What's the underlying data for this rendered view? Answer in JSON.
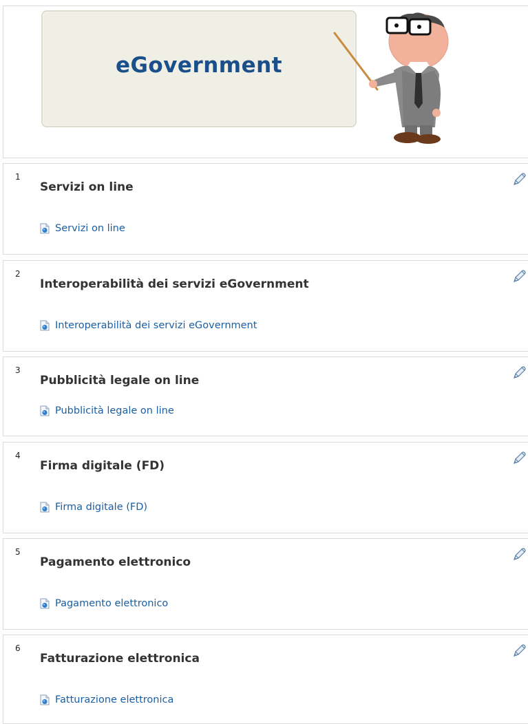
{
  "banner": {
    "title": "eGovernment"
  },
  "colors": {
    "link": "#1a5fa3",
    "title": "#333333",
    "banner_title": "#1a4f8a",
    "board_bg": "#efefe6"
  },
  "sections": [
    {
      "number": "1",
      "title": "Servizi on line",
      "link": "Servizi on line",
      "icon": "document-icon",
      "action_icon": "edit-pencil-icon"
    },
    {
      "number": "2",
      "title": "Interoperabilità dei servizi eGovernment",
      "link": "Interoperabilità dei servizi eGovernment",
      "icon": "document-icon",
      "action_icon": "edit-pencil-icon"
    },
    {
      "number": "3",
      "title": "Pubblicità legale on line",
      "link": "Pubblicità legale on line",
      "icon": "document-icon",
      "action_icon": "edit-pencil-icon"
    },
    {
      "number": "4",
      "title": "Firma digitale (FD)",
      "link": "Firma digitale (FD)",
      "icon": "document-icon",
      "action_icon": "edit-pencil-icon"
    },
    {
      "number": "5",
      "title": "Pagamento elettronico",
      "link": "Pagamento elettronico",
      "icon": "document-icon",
      "action_icon": "edit-pencil-icon"
    },
    {
      "number": "6",
      "title": "Fatturazione elettronica",
      "link": "Fatturazione elettronica",
      "icon": "document-icon",
      "action_icon": "edit-pencil-icon"
    }
  ]
}
